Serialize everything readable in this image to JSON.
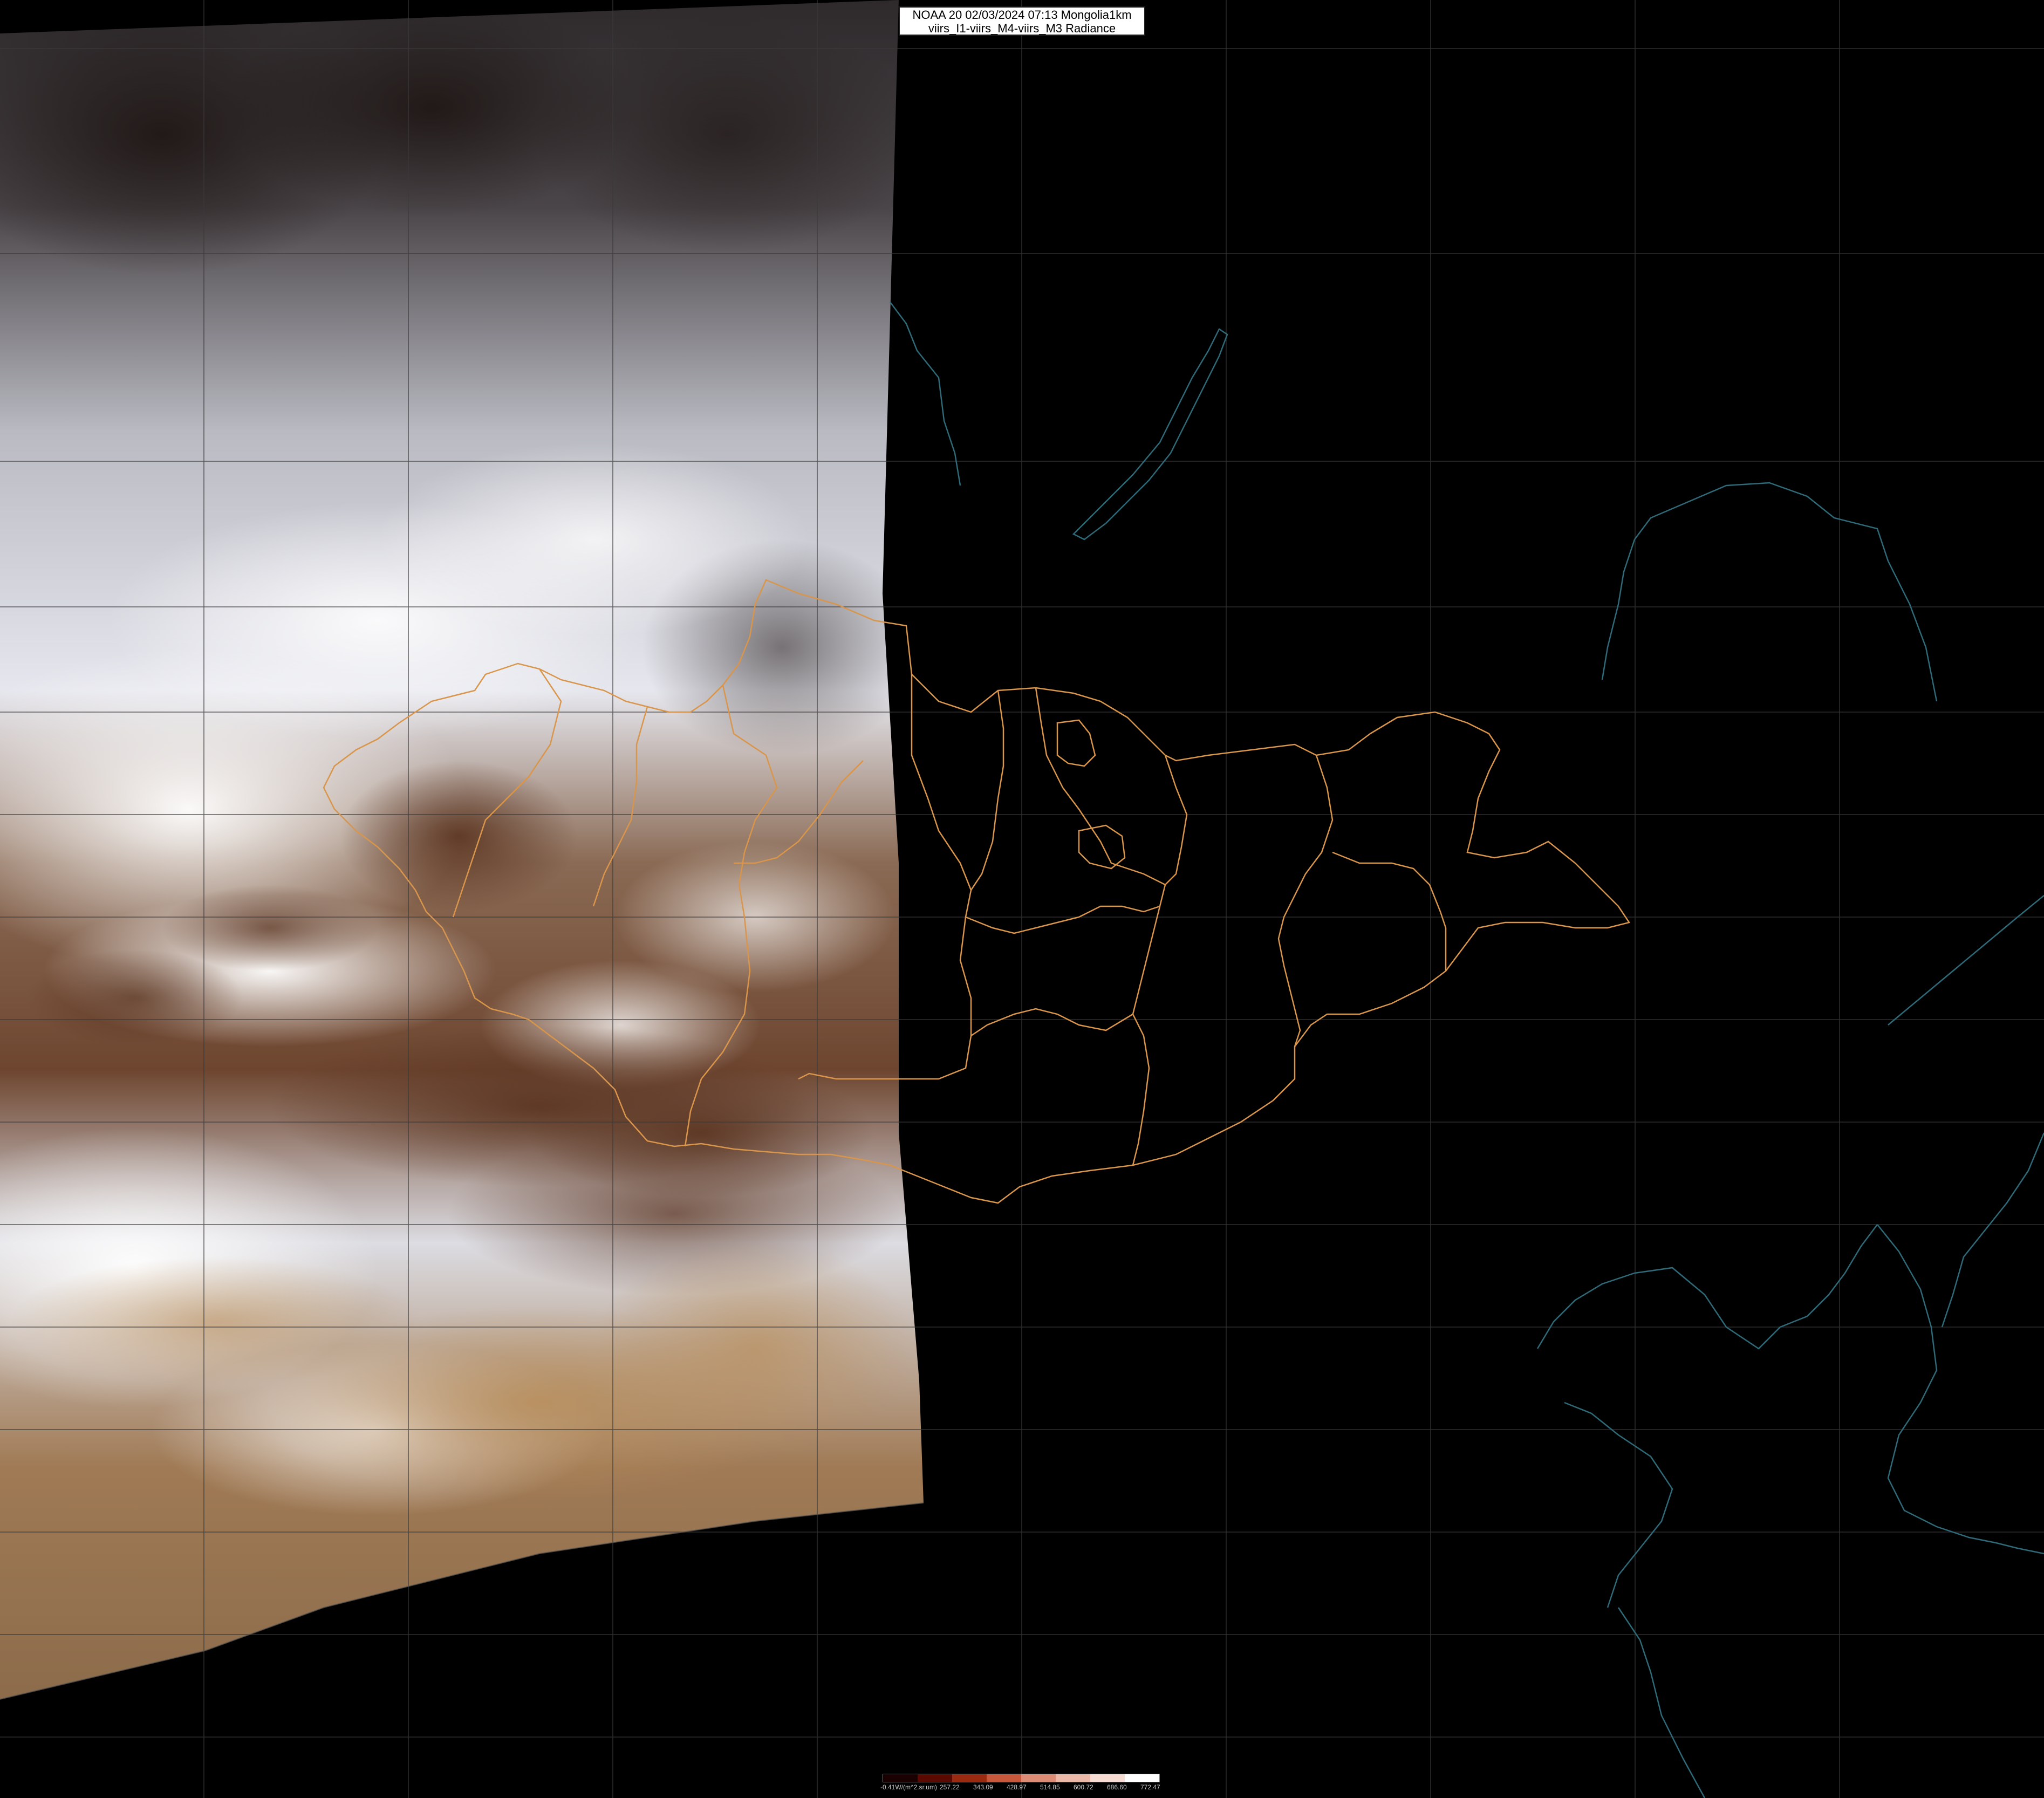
{
  "title": {
    "line1": "NOAA 20 02/03/2024 07:13 Mongolia1km",
    "line2": "viirs_I1-viirs_M4-viirs_M3 Radiance"
  },
  "legend": {
    "labels": [
      "-0.41W/(m^2.sr.um)",
      "257.22",
      "343.09",
      "428.97",
      "514.85",
      "600.72",
      "686.60",
      "772.47"
    ],
    "colors": [
      "#1a0000",
      "#5a0a00",
      "#9a2a10",
      "#c8583c",
      "#dc8c74",
      "#ecb8a8",
      "#f6dcd2",
      "#ffffff"
    ]
  },
  "colors": {
    "boundary": "#d9954a",
    "coastline": "#2e6a78",
    "grid": "#3a3a3a"
  }
}
